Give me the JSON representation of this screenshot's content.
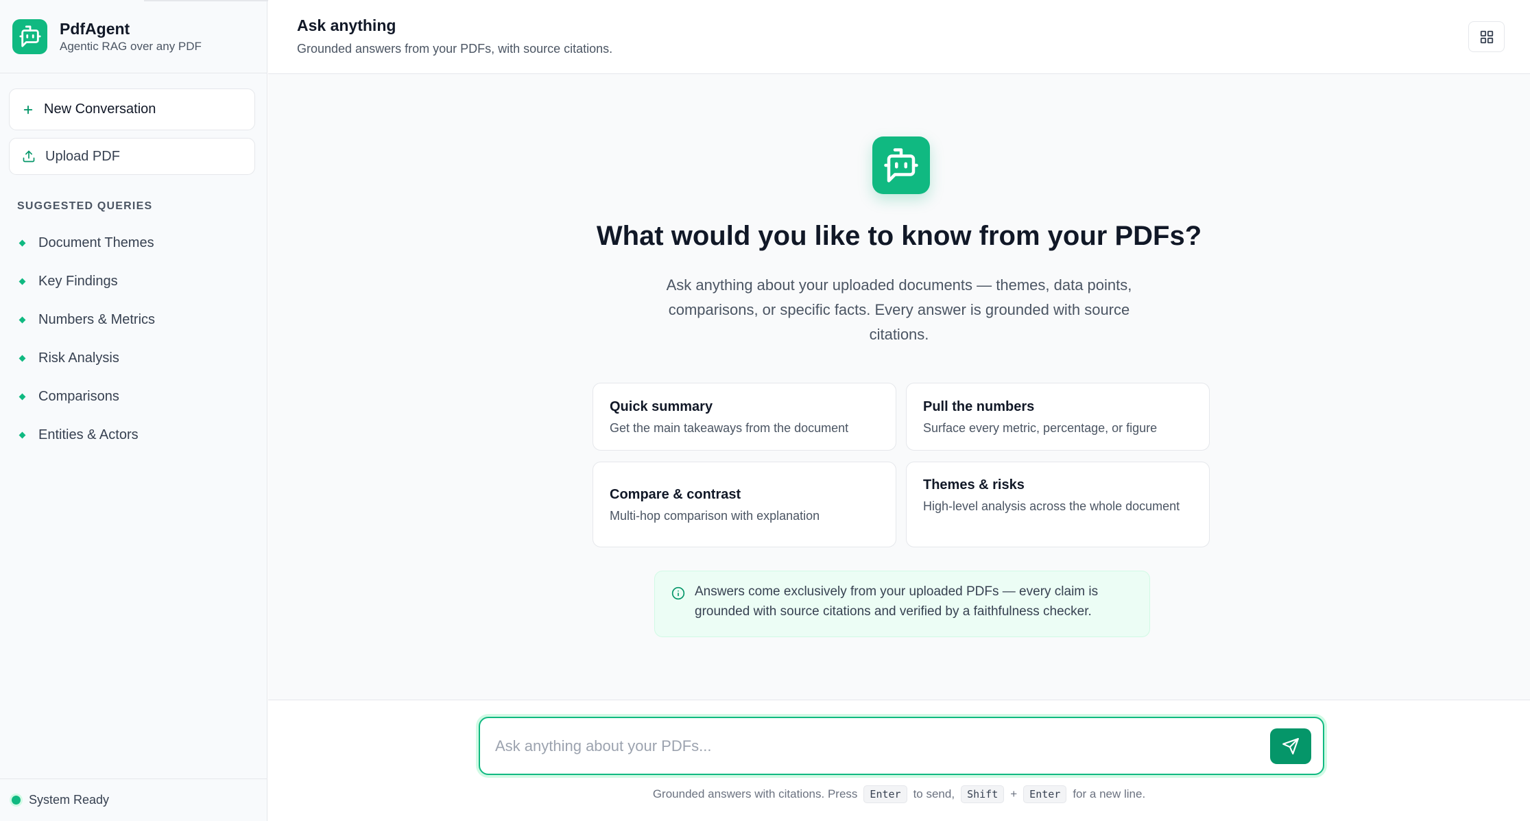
{
  "brand": {
    "title": "PdfAgent",
    "subtitle": "Agentic RAG over any PDF",
    "icon": "bot-message-icon"
  },
  "sidebar": {
    "new_conversation_label": "New Conversation",
    "upload_label": "Upload PDF",
    "section_title": "SUGGESTED QUERIES",
    "queries": [
      {
        "label": "Document Themes"
      },
      {
        "label": "Key Findings"
      },
      {
        "label": "Numbers & Metrics"
      },
      {
        "label": "Risk Analysis"
      },
      {
        "label": "Comparisons"
      },
      {
        "label": "Entities & Actors"
      }
    ],
    "status": "System Ready"
  },
  "header": {
    "title": "Ask anything",
    "subtitle": "Grounded answers from your PDFs, with source citations."
  },
  "hero": {
    "title": "What would you like to know from your PDFs?",
    "description": "Ask anything about your uploaded documents — themes, data points, comparisons, or specific facts. Every answer is grounded with source citations."
  },
  "cards": [
    {
      "title": "Quick summary",
      "description": "Get the main takeaways from the document"
    },
    {
      "title": "Pull the numbers",
      "description": "Surface every metric, percentage, or figure"
    },
    {
      "title": "Compare & contrast",
      "description": "Multi-hop comparison with explanation"
    },
    {
      "title": "Themes & risks",
      "description": "High-level analysis across the whole document"
    }
  ],
  "note": {
    "text": "Answers come exclusively from your uploaded PDFs — every claim is grounded with source citations and verified by a faithfulness checker."
  },
  "composer": {
    "placeholder": "Ask anything about your PDFs...",
    "hint_prefix": "Grounded answers with citations. Press",
    "key_enter": "Enter",
    "hint_mid": "to send,",
    "key_shift": "Shift",
    "plus": "+",
    "hint_suffix": "for a new line."
  },
  "colors": {
    "accent": "#10b981",
    "accent_dark": "#059669",
    "note_bg": "#ecfdf5"
  }
}
